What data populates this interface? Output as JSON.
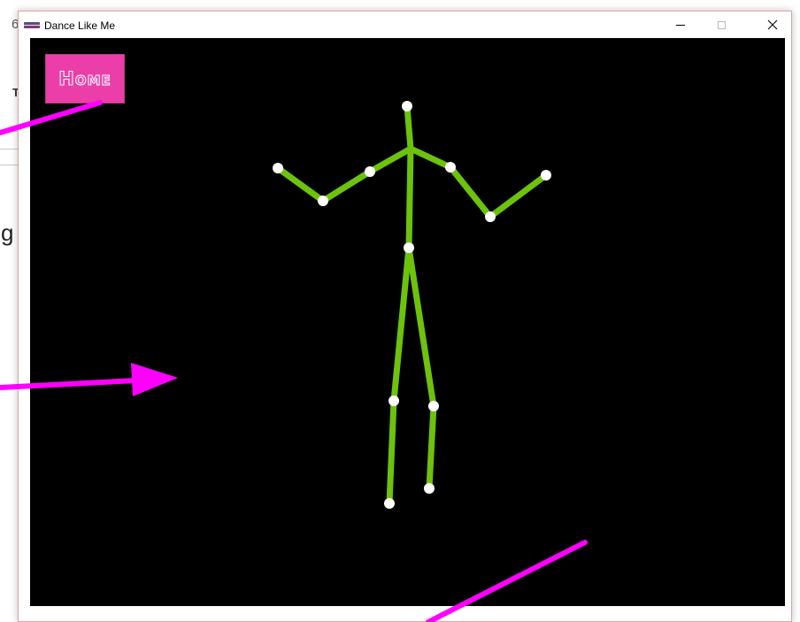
{
  "window": {
    "title": "Dance Like Me",
    "minimize_label": "Minimize",
    "maximize_label": "Maximize",
    "close_label": "Close"
  },
  "home_button": {
    "label": "Home"
  },
  "background_fragments": {
    "top_digit": "6",
    "left_letter": "T",
    "left_char": "g"
  },
  "colors": {
    "canvas": "#000000",
    "skeleton_bone": "#6cc20c",
    "skeleton_joint": "#ffffff",
    "home_button": "#ec3ea8",
    "arrow": "#ff00ff"
  },
  "icons": {
    "app": "app-icon",
    "close": "close-icon",
    "minimize": "minimize-icon",
    "maximize": "maximize-icon"
  }
}
